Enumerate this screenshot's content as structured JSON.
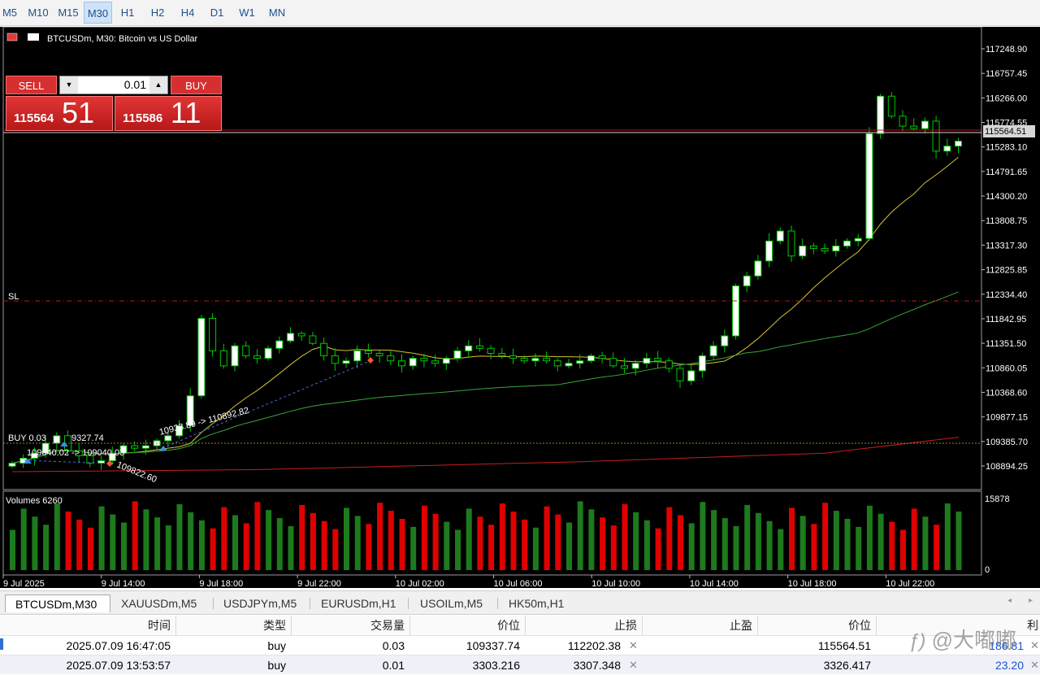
{
  "timeframes": [
    "M5",
    "M10",
    "M15",
    "M30",
    "H1",
    "H2",
    "H4",
    "D1",
    "W1",
    "MN"
  ],
  "active_timeframe": "M30",
  "chart": {
    "title": "BTCUSDm, M30:  Bitcoin vs US Dollar",
    "current_price_label": "115564.51",
    "price_levels": [
      "117248.90",
      "116757.45",
      "116266.00",
      "115774.55",
      "115283.10",
      "114791.65",
      "114300.20",
      "113808.75",
      "113317.30",
      "112825.85",
      "112334.40",
      "111842.95",
      "111351.50",
      "110860.05",
      "110368.60",
      "109877.15",
      "109385.70",
      "108894.25"
    ],
    "time_labels": [
      "9 Jul 2025",
      "9 Jul 14:00",
      "9 Jul 18:00",
      "9 Jul 22:00",
      "10 Jul 02:00",
      "10 Jul 06:00",
      "10 Jul 10:00",
      "10 Jul 14:00",
      "10 Jul 18:00",
      "10 Jul 22:00"
    ],
    "sl_label": "SL",
    "buy_label": "BUY 0.03",
    "trade_annotations": [
      "109040.02 -> 109040.03",
      "10933.89 -> 110892.82",
      "109822.60",
      "9327.74"
    ],
    "volume_title": "Volumes 6260",
    "volume_axis_max": "15878",
    "volume_axis_min": "0",
    "colors": {
      "bull_candle": "#ffffff",
      "bear_candle": "#000000",
      "wick": "#00c800",
      "ma_fast": "#d6c235",
      "ma_mid": "#3aa53a",
      "ma_slow": "#c81e1e",
      "sl_line": "#b01c1c",
      "buy_line": "#8a8a3a",
      "vol_up": "#1d7a1d",
      "vol_down": "#e00000"
    }
  },
  "trade_panel": {
    "sell_label": "SELL",
    "buy_label": "BUY",
    "lot": "0.01",
    "sell_price_small": "115564",
    "sell_price_big": "51",
    "buy_price_small": "115586",
    "buy_price_big": "11"
  },
  "symbol_tabs": [
    "BTCUSDm,M30",
    "XAUUSDm,M5",
    "USDJPYm,M5",
    "EURUSDm,H1",
    "USOILm,M5",
    "HK50m,H1"
  ],
  "table": {
    "headers": [
      "时间",
      "类型",
      "交易量",
      "价位",
      "止损",
      "止盈",
      "价位",
      "利"
    ],
    "rows": [
      {
        "time": "2025.07.09 16:47:05",
        "type": "buy",
        "volume": "0.03",
        "price": "109337.74",
        "sl": "112202.38",
        "tp": "",
        "current": "115564.51",
        "profit": "186.81"
      },
      {
        "time": "2025.07.09 13:53:57",
        "type": "buy",
        "volume": "0.01",
        "price": "3303.216",
        "sl": "3307.348",
        "tp": "",
        "current": "3326.417",
        "profit": "23.20"
      }
    ]
  },
  "watermark": "@大嘟嘟"
}
